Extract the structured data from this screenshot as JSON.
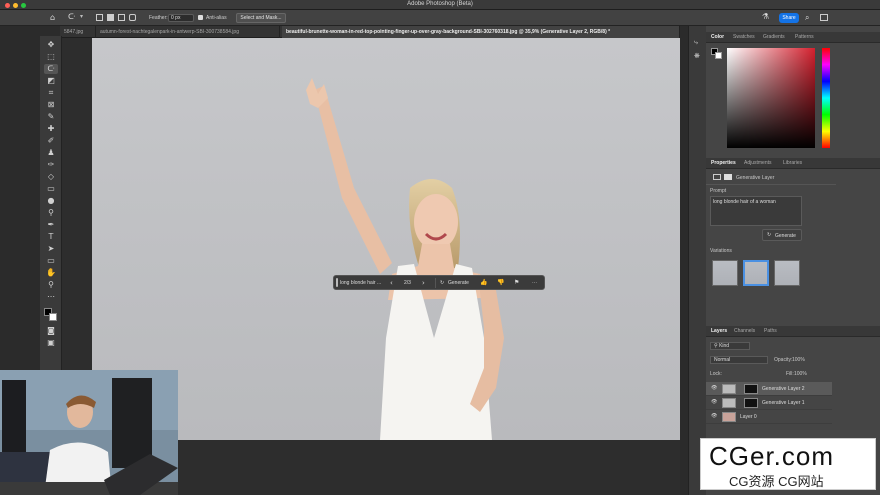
{
  "app": {
    "title": "Adobe Photoshop (Beta)"
  },
  "options_bar": {
    "feather_label": "Feather:",
    "feather_value": "0 px",
    "antialias_label": "Anti-alias",
    "select_mask_label": "Select and Mask...",
    "share_label": "Share"
  },
  "tabs": [
    {
      "label": "5847.jpg"
    },
    {
      "label": "autumn-forest-nachtegalenpark-in-antwerp-SBI-300738584.jpg"
    },
    {
      "label": "beautiful-brunette-woman-in-red-top-pointing-finger-up-over-gray-background-SBI-302760318.jpg @ 35,9% (Generative Layer 2, RGB/8) *"
    }
  ],
  "context_bar": {
    "prompt_value": "long blonde hair ...",
    "counter": "2/3",
    "generate_label": "Generate",
    "more_label": "···"
  },
  "color_panel": {
    "tabs": [
      "Color",
      "Swatches",
      "Gradients",
      "Patterns"
    ]
  },
  "properties_panel": {
    "tabs": [
      "Properties",
      "Adjustments",
      "Libraries"
    ],
    "layer_type": "Generative Layer",
    "prompt_label": "Prompt",
    "prompt_value": "long blonde hair of a woman",
    "generate_label": "Generate",
    "variations_label": "Variations"
  },
  "layers_panel": {
    "tabs": [
      "Layers",
      "Channels",
      "Paths"
    ],
    "filter_kind": "Kind",
    "blend_mode": "Normal",
    "opacity_label": "Opacity:",
    "opacity_value": "100%",
    "lock_label": "Lock:",
    "fill_label": "Fill:",
    "fill_value": "100%",
    "layers": [
      {
        "name": "Generative Layer 2"
      },
      {
        "name": "Generative Layer 1"
      },
      {
        "name": "Layer 0"
      }
    ]
  },
  "watermark": {
    "main": "CGer.com",
    "sub": "CG资源  CG网站"
  },
  "colors": {
    "accent": "#1473e6",
    "panel_bg": "#454545",
    "canvas_bg": "#c3c4c6"
  }
}
